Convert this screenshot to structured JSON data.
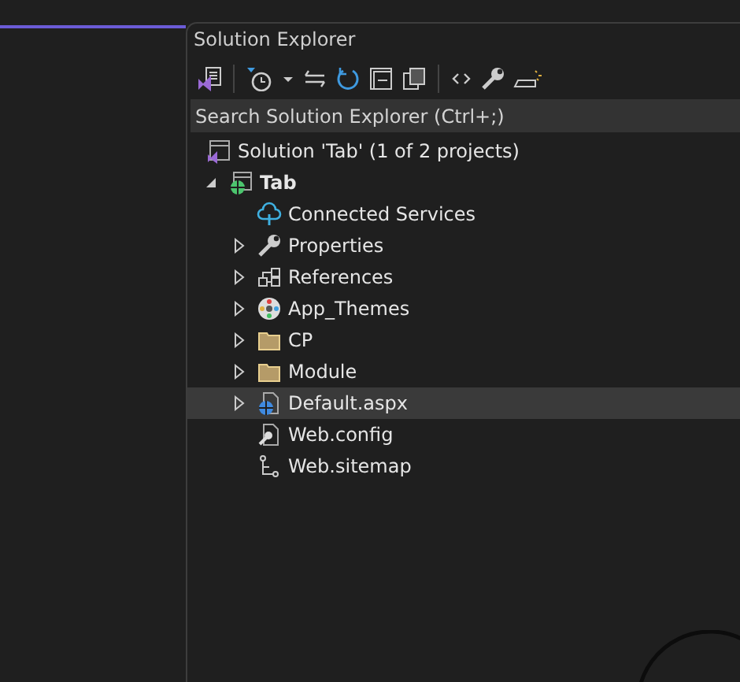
{
  "panel": {
    "title": "Solution Explorer"
  },
  "toolbar": [
    {
      "kind": "switch-views"
    },
    {
      "kind": "separator"
    },
    {
      "kind": "history"
    },
    {
      "kind": "dropdown"
    },
    {
      "kind": "sync"
    },
    {
      "kind": "refresh"
    },
    {
      "kind": "collapse"
    },
    {
      "kind": "copies"
    },
    {
      "kind": "separator"
    },
    {
      "kind": "code"
    },
    {
      "kind": "properties"
    },
    {
      "kind": "preview"
    }
  ],
  "search": {
    "placeholder": "Search Solution Explorer (Ctrl+;)"
  },
  "tree": [
    {
      "label": "Solution 'Tab' (1 of 2 projects)",
      "kind": "solution",
      "selected": false,
      "children": [
        {
          "label": "Tab",
          "kind": "project",
          "expanded": true,
          "selected": false,
          "children": [
            {
              "label": "Connected Services",
              "kind": "cloud",
              "selected": false
            },
            {
              "label": "Properties",
              "kind": "wrench",
              "expanded": false,
              "selected": false
            },
            {
              "label": "References",
              "kind": "references",
              "expanded": false,
              "selected": false
            },
            {
              "label": "App_Themes",
              "kind": "themes",
              "expanded": false,
              "selected": false
            },
            {
              "label": "CP",
              "kind": "folder",
              "expanded": false,
              "selected": false
            },
            {
              "label": "Module",
              "kind": "folder",
              "expanded": false,
              "selected": false
            },
            {
              "label": "Default.aspx",
              "kind": "webpage",
              "expanded": false,
              "selected": true
            },
            {
              "label": "Web.config",
              "kind": "config",
              "selected": false
            },
            {
              "label": "Web.sitemap",
              "kind": "sitemap",
              "selected": false
            }
          ]
        }
      ]
    }
  ]
}
